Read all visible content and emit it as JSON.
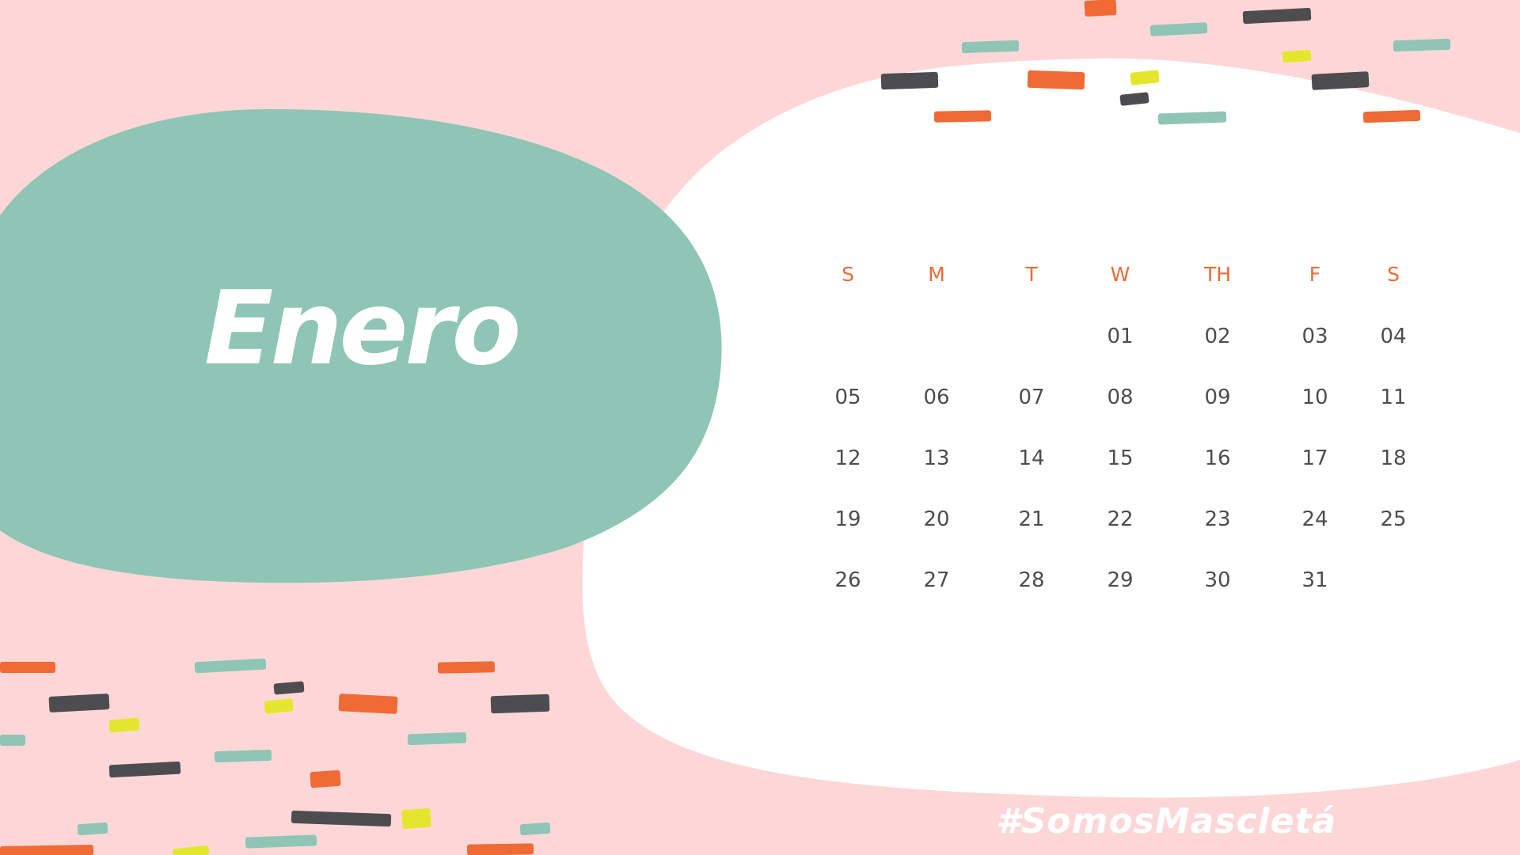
{
  "month": "Enero",
  "weekdays": [
    "S",
    "M",
    "T",
    "W",
    "TH",
    "F",
    "S"
  ],
  "weeks": [
    [
      "",
      "",
      "",
      "01",
      "02",
      "03",
      "04"
    ],
    [
      "05",
      "06",
      "07",
      "08",
      "09",
      "10",
      "11"
    ],
    [
      "12",
      "13",
      "14",
      "15",
      "16",
      "17",
      "18"
    ],
    [
      "19",
      "20",
      "21",
      "22",
      "23",
      "24",
      "25"
    ],
    [
      "26",
      "27",
      "28",
      "29",
      "30",
      "31",
      ""
    ]
  ],
  "hashtag": "#SomosMascletá",
  "colors": {
    "background": "#fdd7d7",
    "green_blob": "#8ec5b5",
    "white_blob": "#ffffff",
    "weekday_text": "#ef6a35",
    "day_text": "#4d4d4f",
    "confetti_orange": "#ef6a35",
    "confetti_teal": "#8ec5b5",
    "confetti_dark": "#4d4d4f",
    "confetti_yellow": "#e4e62e"
  },
  "decor": {
    "confetti": "hand-drawn confetti dash strokes"
  }
}
